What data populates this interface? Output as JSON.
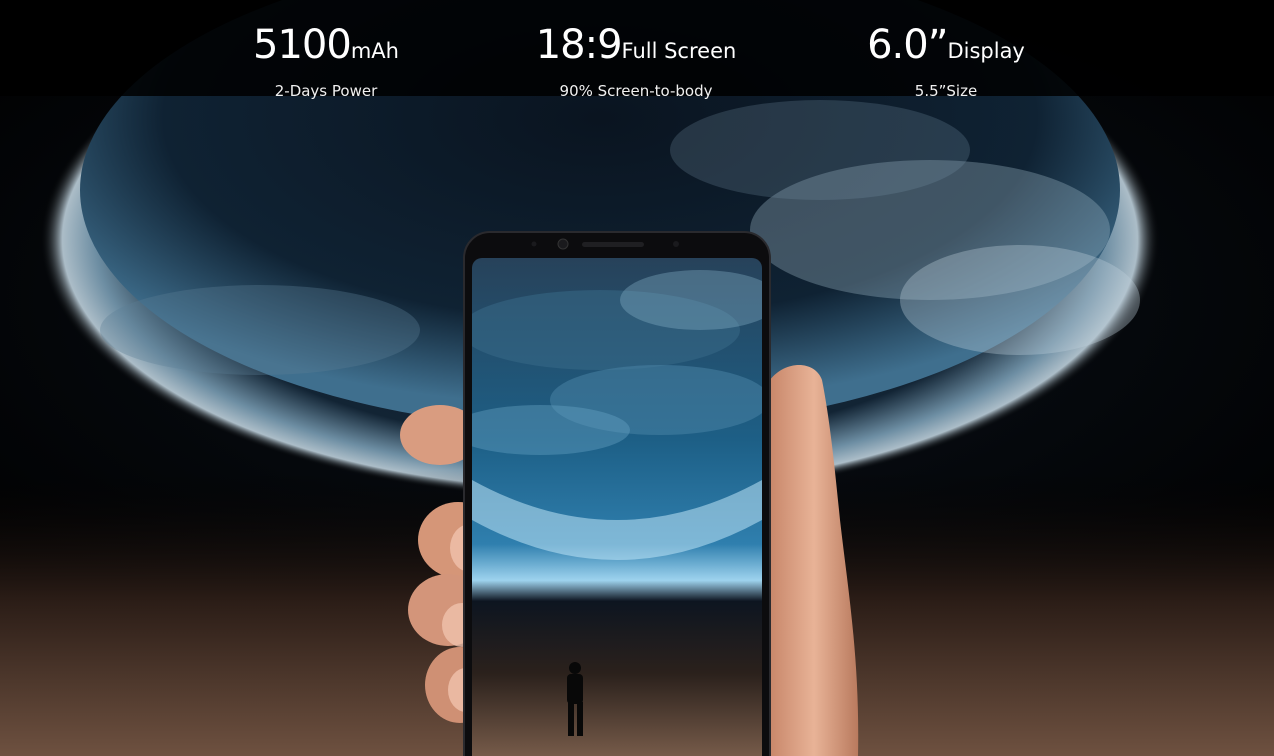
{
  "specs": [
    {
      "value": "5100",
      "unit": "mAh",
      "caption": "2-Days Power"
    },
    {
      "value": "18:9",
      "unit": "Full Screen",
      "caption": "90% Screen-to-body"
    },
    {
      "value": "6.0”",
      "unit": "Display",
      "caption": "5.5”Size"
    }
  ],
  "colors": {
    "background": "#000000",
    "earth_glow": "#8fb4cc",
    "ocean": "#1c4a6a",
    "desert": "#6b4f3e",
    "skin": "#e2a888",
    "text": "#ffffff"
  }
}
